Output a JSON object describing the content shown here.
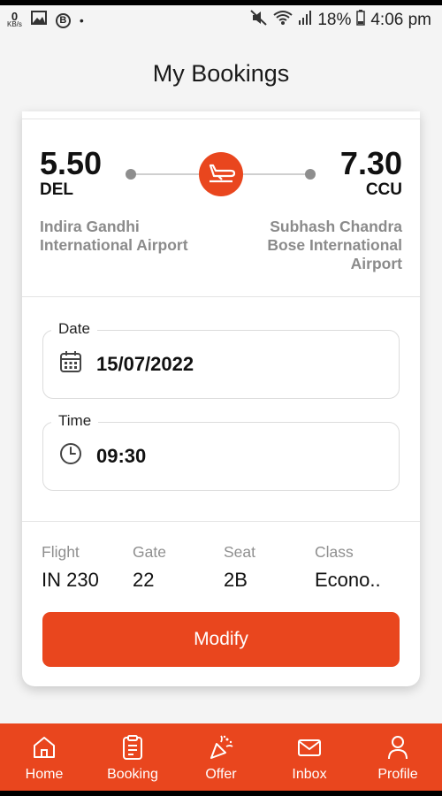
{
  "status_bar": {
    "kb_value": "0",
    "kb_unit": "KB/s",
    "notif_b": "B",
    "dot": "•",
    "battery": "18%",
    "time": "4:06 pm"
  },
  "page": {
    "title": "My Bookings"
  },
  "flight": {
    "departure": {
      "time": "5.50",
      "code": "DEL",
      "airport": "Indira Gandhi International Airport"
    },
    "arrival": {
      "time": "7.30",
      "code": "CCU",
      "airport": "Subhash Chandra Bose International Airport"
    }
  },
  "date_field": {
    "label": "Date",
    "value": "15/07/2022"
  },
  "time_field": {
    "label": "Time",
    "value": "09:30"
  },
  "info": [
    {
      "label": "Flight",
      "value": "IN 230"
    },
    {
      "label": "Gate",
      "value": "22"
    },
    {
      "label": "Seat",
      "value": "2B"
    },
    {
      "label": "Class",
      "value": "Econo.."
    }
  ],
  "modify_label": "Modify",
  "nav": [
    {
      "label": "Home",
      "icon": "home-icon"
    },
    {
      "label": "Booking",
      "icon": "clipboard-icon"
    },
    {
      "label": "Offer",
      "icon": "party-popper-icon"
    },
    {
      "label": "Inbox",
      "icon": "mail-icon"
    },
    {
      "label": "Profile",
      "icon": "user-icon"
    }
  ],
  "colors": {
    "accent": "#e9461e",
    "muted_text": "#8b8b8b",
    "background": "#f4f4f4"
  }
}
